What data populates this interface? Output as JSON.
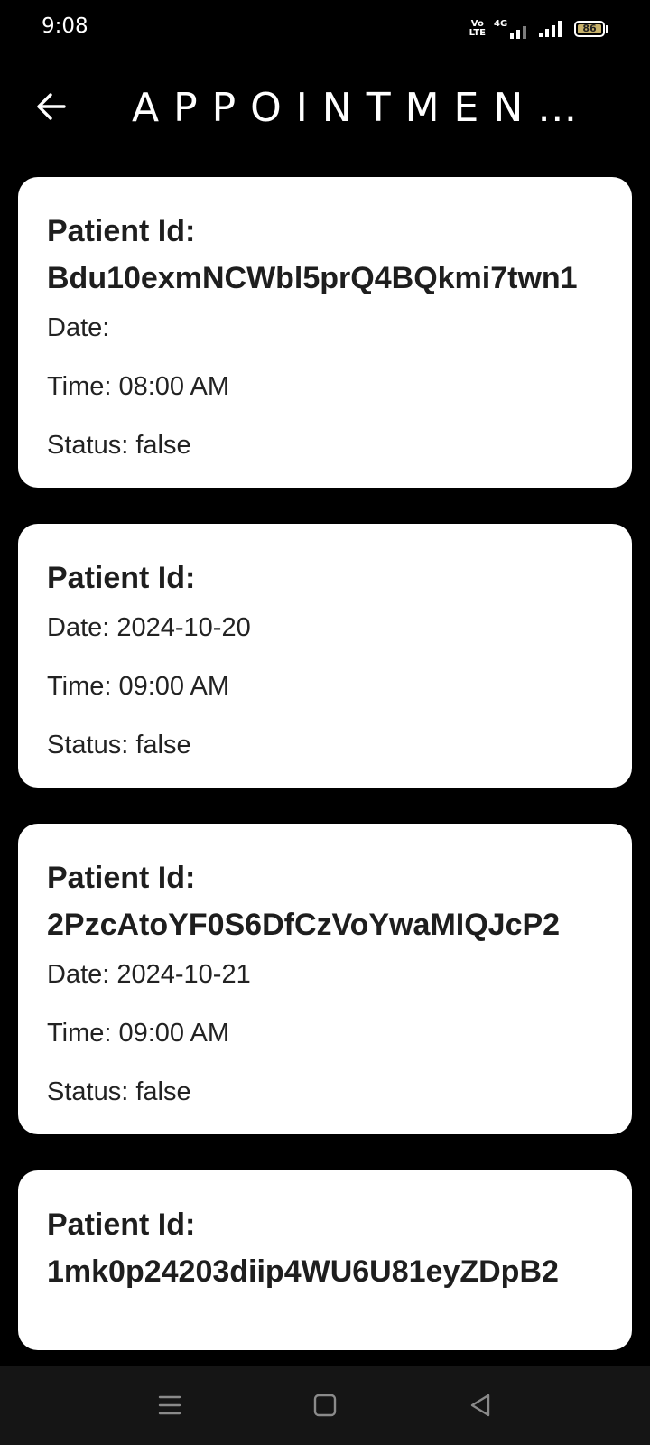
{
  "status_bar": {
    "time": "9:08",
    "volte_top": "Vo",
    "volte_bottom": "LTE",
    "network": "4G",
    "battery": "86"
  },
  "app_bar": {
    "title": "APPOINTMENTS"
  },
  "appointments": [
    {
      "patient_label": "Patient Id:",
      "patient_id": "Bdu10exmNCWbl5prQ4BQkmi7twn1",
      "date": "Date: ",
      "time": "Time: 08:00 AM",
      "status": "Status: false"
    },
    {
      "patient_label": "Patient Id:",
      "patient_id": "",
      "date": "Date: 2024-10-20",
      "time": "Time: 09:00 AM",
      "status": "Status: false"
    },
    {
      "patient_label": "Patient Id:",
      "patient_id": "2PzcAtoYF0S6DfCzVoYwaMIQJcP2",
      "date": "Date: 2024-10-21",
      "time": "Time: 09:00 AM",
      "status": "Status: false"
    },
    {
      "patient_label": "Patient Id:",
      "patient_id": "1mk0p24203diip4WU6U81eyZDpB2",
      "date": "",
      "time": "",
      "status": ""
    }
  ],
  "icons": {
    "back": "arrow-left-icon",
    "menu": "menu-icon",
    "home": "square-home-icon",
    "back_nav": "triangle-back-icon"
  }
}
